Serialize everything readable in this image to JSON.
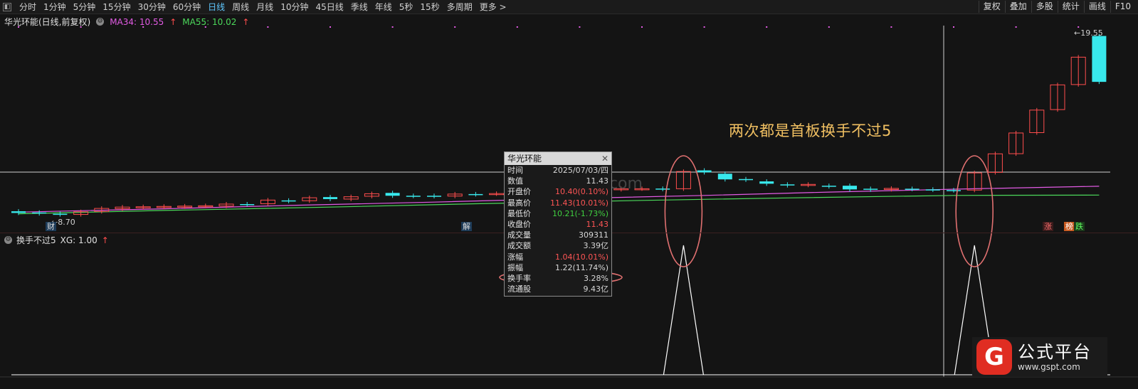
{
  "toolbar": {
    "left_items": [
      {
        "label": "分时",
        "active": false
      },
      {
        "label": "1分钟",
        "active": false
      },
      {
        "label": "5分钟",
        "active": false
      },
      {
        "label": "15分钟",
        "active": false
      },
      {
        "label": "30分钟",
        "active": false
      },
      {
        "label": "60分钟",
        "active": false
      },
      {
        "label": "日线",
        "active": true
      },
      {
        "label": "周线",
        "active": false
      },
      {
        "label": "月线",
        "active": false
      },
      {
        "label": "10分钟",
        "active": false
      },
      {
        "label": "45日线",
        "active": false
      },
      {
        "label": "季线",
        "active": false
      },
      {
        "label": "年线",
        "active": false
      },
      {
        "label": "5秒",
        "active": false
      },
      {
        "label": "15秒",
        "active": false
      },
      {
        "label": "多周期",
        "active": false
      },
      {
        "label": "更多 >",
        "active": false
      }
    ],
    "right_items": [
      "复权",
      "叠加",
      "多股",
      "统计",
      "画线",
      "F10"
    ]
  },
  "pane1": {
    "stock_name": "华光环能(日线,前复权)",
    "ma34_label": "MA34: 10.55",
    "ma55_label": "MA55: 10.02",
    "high_label": "19.55",
    "low_label": "8.70"
  },
  "pane2": {
    "title": "换手不过5",
    "xg_label": "XG: 1.00"
  },
  "annotation": "两次都是首板换手不过5",
  "tags": {
    "cai": "财",
    "jie": "解",
    "zhang": "涨",
    "bang": "榜",
    "die": "跌"
  },
  "watermark": "www.gspt.com",
  "info": {
    "title": "华光环能",
    "rows": [
      {
        "k": "时间",
        "v": "2025/07/03/四",
        "c": ""
      },
      {
        "k": "数值",
        "v": "11.43",
        "c": ""
      },
      {
        "k": "开盘价",
        "v": "10.40(0.10%)",
        "c": "red"
      },
      {
        "k": "最高价",
        "v": "11.43(10.01%)",
        "c": "red"
      },
      {
        "k": "最低价",
        "v": "10.21(-1.73%)",
        "c": "green"
      },
      {
        "k": "收盘价",
        "v": "11.43",
        "c": "red"
      },
      {
        "k": "成交量",
        "v": "309311",
        "c": ""
      },
      {
        "k": "成交额",
        "v": "3.39亿",
        "c": ""
      },
      {
        "k": "涨幅",
        "v": "1.04(10.01%)",
        "c": "red"
      },
      {
        "k": "振幅",
        "v": "1.22(11.74%)",
        "c": ""
      },
      {
        "k": "换手率",
        "v": "3.28%",
        "c": ""
      },
      {
        "k": "流通股",
        "v": "9.43亿",
        "c": ""
      }
    ]
  },
  "logo": {
    "name": "公式平台",
    "url": "www.gspt.com",
    "letter": "G"
  },
  "colors": {
    "up": "#ff4d4d",
    "down": "#38e8ec",
    "ma34": "#e35be5",
    "ma55": "#4cd95b",
    "highlight": "#e07070",
    "annotation": "#f1c062"
  },
  "chart_data": {
    "type": "candlestick",
    "title": "华光环能(日线,前复权)",
    "candles": [
      {
        "o": 9.05,
        "c": 8.95
      },
      {
        "o": 8.98,
        "c": 8.92
      },
      {
        "o": 8.9,
        "c": 8.86
      },
      {
        "o": 8.86,
        "c": 9.02
      },
      {
        "o": 9.04,
        "c": 9.22
      },
      {
        "o": 9.2,
        "c": 9.3
      },
      {
        "o": 9.28,
        "c": 9.32
      },
      {
        "o": 9.3,
        "c": 9.34
      },
      {
        "o": 9.32,
        "c": 9.36
      },
      {
        "o": 9.36,
        "c": 9.38
      },
      {
        "o": 9.36,
        "c": 9.48
      },
      {
        "o": 9.48,
        "c": 9.46
      },
      {
        "o": 9.5,
        "c": 9.72
      },
      {
        "o": 9.7,
        "c": 9.66
      },
      {
        "o": 9.68,
        "c": 9.86
      },
      {
        "o": 9.9,
        "c": 9.78
      },
      {
        "o": 9.78,
        "c": 9.92
      },
      {
        "o": 9.95,
        "c": 10.1
      },
      {
        "o": 10.15,
        "c": 9.98
      },
      {
        "o": 9.98,
        "c": 9.96
      },
      {
        "o": 9.98,
        "c": 9.95
      },
      {
        "o": 9.96,
        "c": 10.08
      },
      {
        "o": 10.08,
        "c": 10.06
      },
      {
        "o": 10.1,
        "c": 10.11
      },
      {
        "o": 10.2,
        "c": 10.18
      },
      {
        "o": 10.25,
        "c": 10.3
      },
      {
        "o": 10.32,
        "c": 10.3
      },
      {
        "o": 10.36,
        "c": 10.38
      },
      {
        "o": 10.42,
        "c": 10.34
      },
      {
        "o": 10.36,
        "c": 10.4
      },
      {
        "o": 10.4,
        "c": 10.4
      },
      {
        "o": 10.41,
        "c": 10.38
      },
      {
        "o": 10.4,
        "c": 11.43
      },
      {
        "o": 11.5,
        "c": 11.38
      },
      {
        "o": 11.3,
        "c": 10.96
      },
      {
        "o": 10.98,
        "c": 10.94
      },
      {
        "o": 10.84,
        "c": 10.7
      },
      {
        "o": 10.66,
        "c": 10.6
      },
      {
        "o": 10.62,
        "c": 10.66
      },
      {
        "o": 10.58,
        "c": 10.54
      },
      {
        "o": 10.58,
        "c": 10.36
      },
      {
        "o": 10.4,
        "c": 10.34
      },
      {
        "o": 10.36,
        "c": 10.42
      },
      {
        "o": 10.4,
        "c": 10.38
      },
      {
        "o": 10.36,
        "c": 10.34
      },
      {
        "o": 10.32,
        "c": 10.3
      },
      {
        "o": 10.32,
        "c": 11.35
      },
      {
        "o": 11.38,
        "c": 12.49
      },
      {
        "o": 12.5,
        "c": 13.74
      },
      {
        "o": 13.76,
        "c": 15.11
      },
      {
        "o": 15.14,
        "c": 16.62
      },
      {
        "o": 16.64,
        "c": 18.28
      },
      {
        "o": 19.55,
        "c": 16.8
      }
    ],
    "ma34": [
      9.0,
      9.2,
      9.4,
      9.6,
      9.8,
      10.0,
      10.2,
      10.4,
      10.55
    ],
    "ma55": [
      8.9,
      9.1,
      9.3,
      9.5,
      9.7,
      9.85,
      10.0,
      10.02
    ],
    "indicator": {
      "name": "换手不过5",
      "signal_indices": [
        32,
        46
      ],
      "value": 1.0
    },
    "ylim": [
      8.5,
      20.0
    ]
  }
}
